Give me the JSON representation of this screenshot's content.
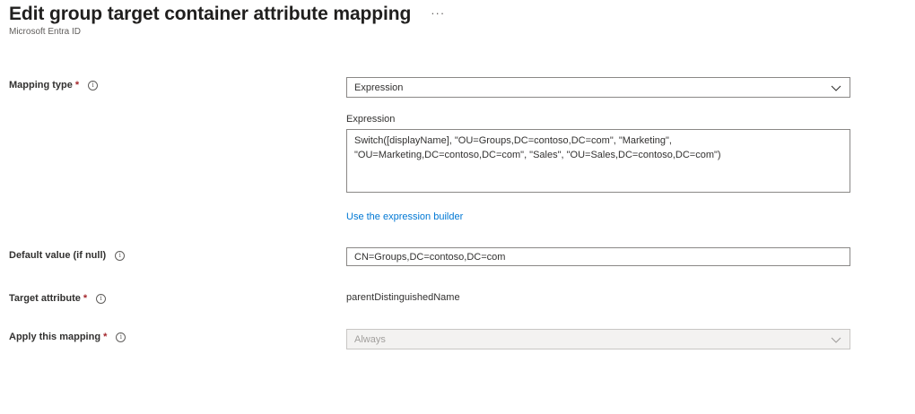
{
  "header": {
    "title": "Edit group target container attribute mapping",
    "more": "···",
    "subtitle": "Microsoft Entra ID"
  },
  "mapping_type": {
    "label": "Mapping type",
    "required": "*",
    "value": "Expression"
  },
  "expression": {
    "label": "Expression",
    "value": "Switch([displayName], \"OU=Groups,DC=contoso,DC=com\", \"Marketing\",\n\"OU=Marketing,DC=contoso,DC=com\", \"Sales\", \"OU=Sales,DC=contoso,DC=com\")",
    "builder_link": "Use the expression builder"
  },
  "default_value": {
    "label": "Default value (if null)",
    "value": "CN=Groups,DC=contoso,DC=com"
  },
  "target_attribute": {
    "label": "Target attribute",
    "required": "*",
    "value": "parentDistinguishedName"
  },
  "apply_mapping": {
    "label": "Apply this mapping",
    "required": "*",
    "value": "Always"
  },
  "icons": {
    "info": "info-icon",
    "chevron": "chevron-down-icon"
  }
}
